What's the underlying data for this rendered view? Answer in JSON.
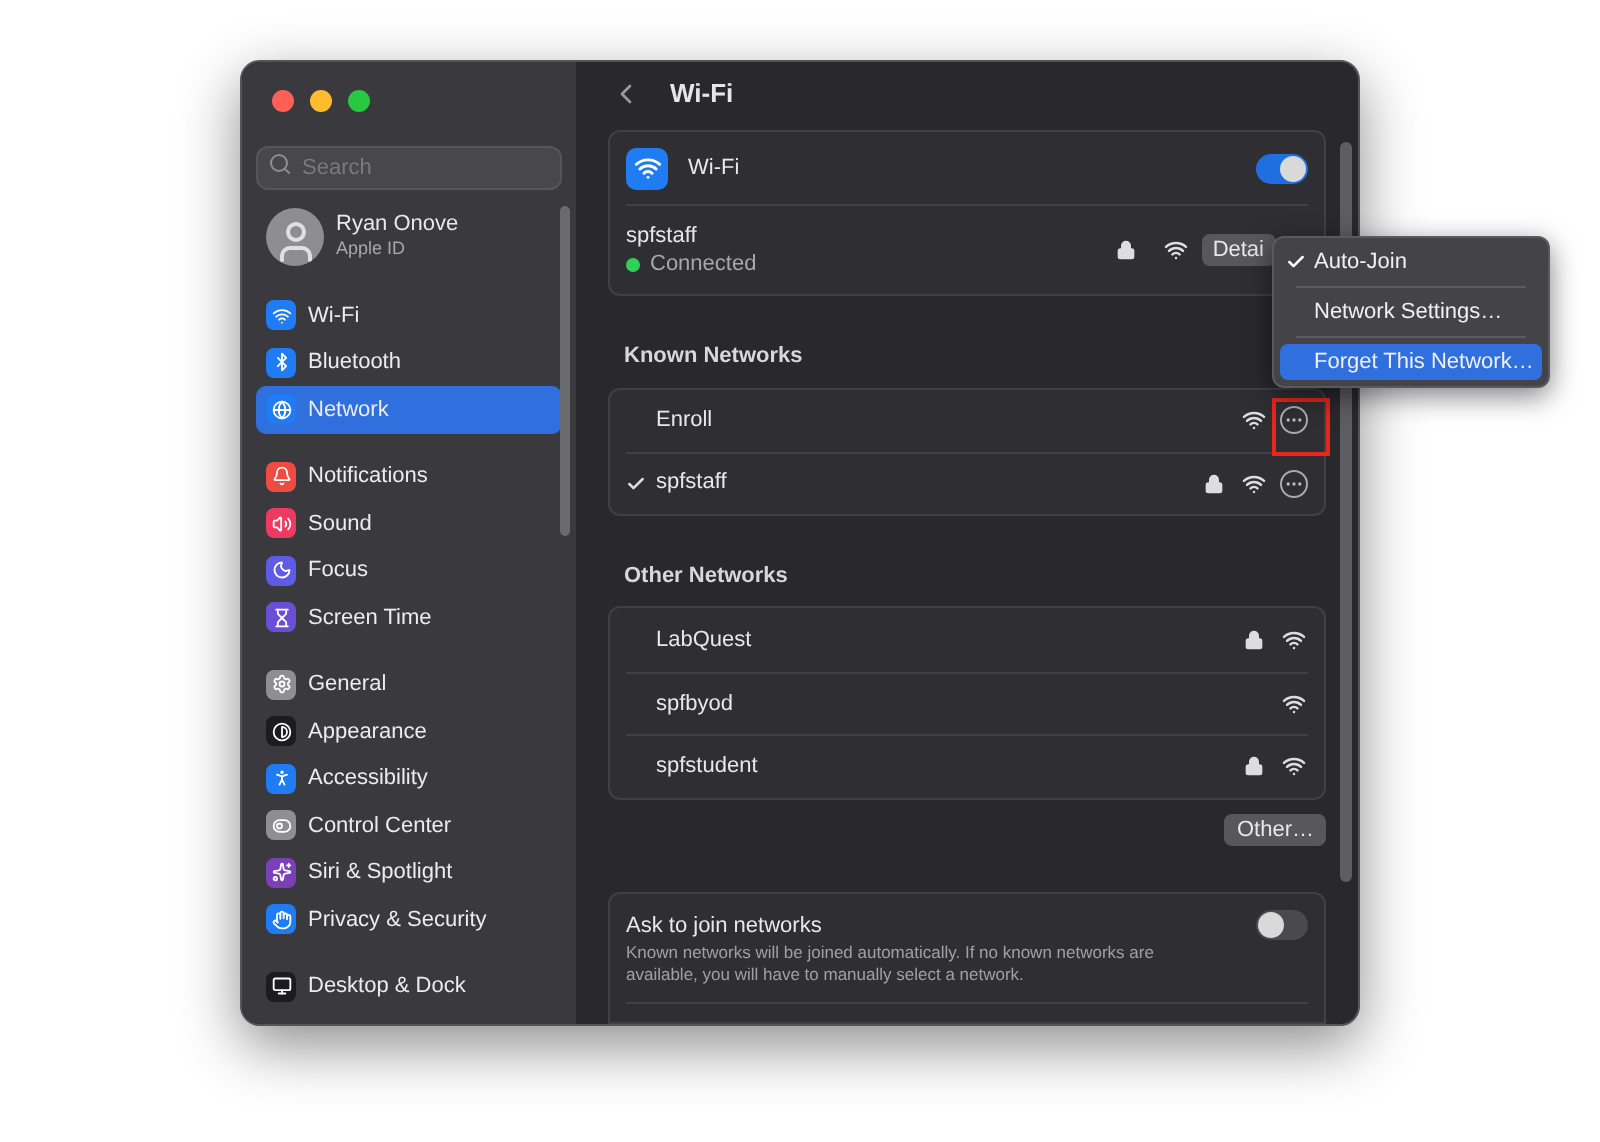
{
  "window": {
    "title": "Wi-Fi"
  },
  "sidebar": {
    "search": {
      "placeholder": "Search"
    },
    "account": {
      "name": "Ryan Onove",
      "subtitle": "Apple ID"
    },
    "groups": [
      {
        "items": [
          {
            "label": "Wi-Fi",
            "color": "#1f7cf3",
            "selected": false
          },
          {
            "label": "Bluetooth",
            "color": "#1f7cf3",
            "selected": false
          },
          {
            "label": "Network",
            "color": "#1f7cf3",
            "selected": true
          }
        ]
      },
      {
        "items": [
          {
            "label": "Notifications",
            "color": "#ee4b43",
            "selected": false
          },
          {
            "label": "Sound",
            "color": "#ee3a62",
            "selected": false
          },
          {
            "label": "Focus",
            "color": "#5e5ce6",
            "selected": false
          },
          {
            "label": "Screen Time",
            "color": "#6a4fd6",
            "selected": false
          }
        ]
      },
      {
        "items": [
          {
            "label": "General",
            "color": "#8e8e93",
            "selected": false
          },
          {
            "label": "Appearance",
            "color": "#1c1c1e",
            "selected": false
          },
          {
            "label": "Accessibility",
            "color": "#1f7cf3",
            "selected": false
          },
          {
            "label": "Control Center",
            "color": "#8e8e93",
            "selected": false
          },
          {
            "label": "Siri & Spotlight",
            "color": "#7b3fb8",
            "selected": false
          },
          {
            "label": "Privacy & Security",
            "color": "#1f7cf3",
            "selected": false
          }
        ]
      },
      {
        "items": [
          {
            "label": "Desktop & Dock",
            "color": "#1c1c1e",
            "selected": false
          }
        ]
      }
    ]
  },
  "wifi": {
    "label": "Wi-Fi",
    "on": true,
    "current": {
      "name": "spfstaff",
      "status": "Connected",
      "connected": true,
      "locked": true,
      "details": "Detai"
    }
  },
  "known_networks": {
    "title": "Known Networks",
    "items": [
      {
        "name": "Enroll",
        "current": false,
        "locked": false,
        "highlighted": true
      },
      {
        "name": "spfstaff",
        "current": true,
        "locked": true,
        "highlighted": false
      }
    ]
  },
  "other_networks": {
    "title": "Other Networks",
    "items": [
      {
        "name": "LabQuest",
        "locked": true
      },
      {
        "name": "spfbyod",
        "locked": false
      },
      {
        "name": "spfstudent",
        "locked": true
      }
    ],
    "other_button": "Other…"
  },
  "ask_to_join": {
    "title": "Ask to join networks",
    "description": "Known networks will be joined automatically. If no known networks are available, you will have to manually select a network.",
    "on": false
  },
  "context_menu": {
    "items": [
      {
        "label": "Auto-Join",
        "checked": true,
        "selected": false
      },
      {
        "label": "Network Settings…",
        "checked": false,
        "selected": false
      },
      {
        "label": "Forget This Network…",
        "checked": false,
        "selected": true
      }
    ]
  }
}
